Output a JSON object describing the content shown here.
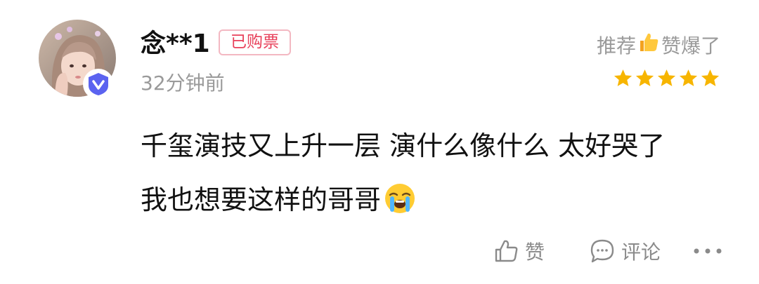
{
  "user": {
    "name": "念**1",
    "ticket_badge": "已购票",
    "time_ago": "32分钟前"
  },
  "rating": {
    "label_prefix": "推荐",
    "label_suffix": "赞爆了",
    "label_emoji": "thumbs-up-emoji",
    "stars": 5,
    "max_stars": 5,
    "star_color": "#f7b500"
  },
  "comment": {
    "line1": "千玺演技又上升一层 演什么像什么 太好哭了",
    "line2": "我也想要这样的哥哥",
    "emoji": "loudly-crying-face-emoji"
  },
  "actions": {
    "like_label": "赞",
    "comment_label": "评论",
    "more_icon": "more-dots-icon"
  },
  "colors": {
    "badge_text": "#e8405a",
    "badge_border": "#f3b8c2",
    "verified_badge": "#5b63f0",
    "muted_text": "#9a9a9a"
  }
}
